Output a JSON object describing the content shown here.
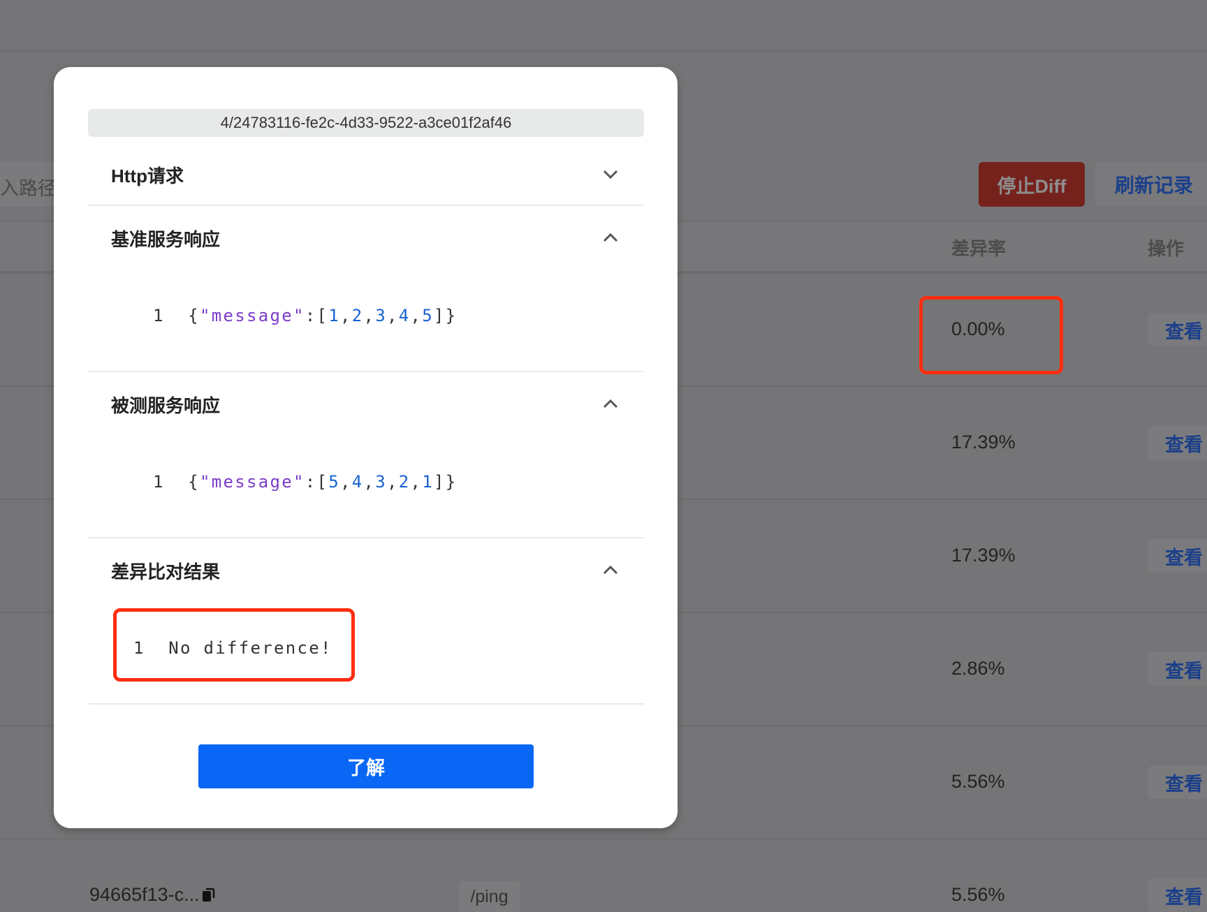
{
  "background": {
    "search_placeholder": "入路径",
    "stop_diff_label": "停止Diff",
    "refresh_label": "刷新记录",
    "columns": {
      "diff_rate": "差异率",
      "actions": "操作"
    },
    "rows": [
      {
        "rate": "0.00%",
        "action": "查看"
      },
      {
        "rate": "17.39%",
        "action": "查看"
      },
      {
        "rate": "17.39%",
        "action": "查看"
      },
      {
        "rate": "2.86%",
        "action": "查看"
      },
      {
        "rate": "5.56%",
        "action": "查看"
      },
      {
        "id": "94665f13-c...",
        "path": "/ping",
        "rate": "5.56%",
        "action": "查看"
      }
    ],
    "colors": {
      "stop": "#75221d",
      "highlight": "#ff2d0f"
    }
  },
  "modal": {
    "record_id": "4/24783116-fe2c-4d33-9522-a3ce01f2af46",
    "sections": [
      {
        "title": "Http请求",
        "expanded": false
      },
      {
        "title": "基准服务响应",
        "expanded": true,
        "line_no": "1",
        "code": {
          "open": "{",
          "key": "\"message\"",
          "colon": ":[",
          "values": [
            "1",
            "2",
            "3",
            "4",
            "5"
          ],
          "close": "]}"
        }
      },
      {
        "title": "被测服务响应",
        "expanded": true,
        "line_no": "1",
        "code": {
          "open": "{",
          "key": "\"message\"",
          "colon": ":[",
          "values": [
            "5",
            "4",
            "3",
            "2",
            "1"
          ],
          "close": "]}"
        }
      },
      {
        "title": "差异比对结果",
        "expanded": true,
        "line_no": "1",
        "result": "No difference!"
      }
    ],
    "ok_label": "了解",
    "accent": "#0a66f5"
  }
}
